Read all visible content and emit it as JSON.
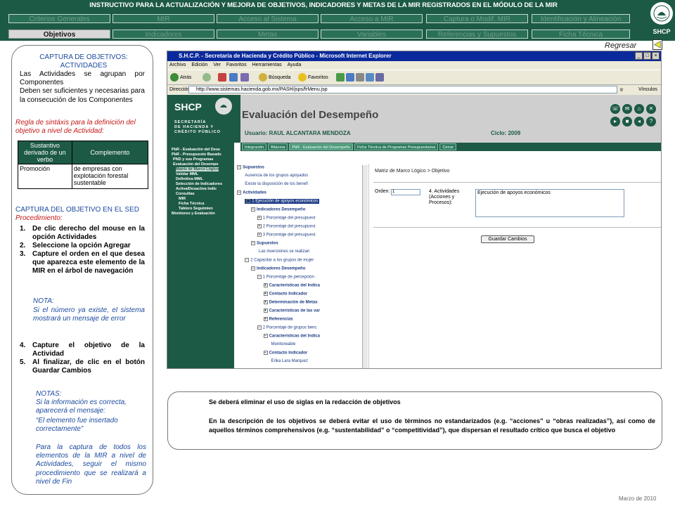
{
  "header": {
    "title": "INSTRUCTIVO PARA  LA ACTUALIZACIÓN Y MEJORA DE OBJETIVOS, INDICADORES Y METAS DE LA MIR REGISTRADOS EN EL MÓDULO DE LA MIR",
    "nav_row1": [
      "Criterios Generales",
      "MIR",
      "Acceso al Sistema",
      "Acceso a MIR",
      "Captura o Modif. MIR",
      "Identificación y Alineación"
    ],
    "nav_row2": [
      "Objetivos",
      "Indicadores",
      "Metas",
      "Variables",
      "Referencias y Supuestos",
      "Ficha Técnica"
    ],
    "active_tab": "Objetivos",
    "logo_text": "SHCP",
    "colors": {
      "header_bg": "#1d5a45",
      "inactive_btn": "#2a7057",
      "active_btn": "#d8d8d8"
    }
  },
  "regresar": "Regresar",
  "left_panel": {
    "heading": "CAPTURA DE OBJETIVOS: ACTIVIDADES",
    "intro": "Las Actividades se agrupan por Componentes\nDeben ser suficientes y necesarias para la consecución de los Componentes",
    "rule": "Regla de sintáxis para la definición del objetivo a nivel de Actividad:",
    "table": {
      "headers": [
        "Sustantivo derivado de un verbo",
        "Complemento"
      ],
      "row": [
        "Promoción",
        "de empresas con explotación forestal sustentable"
      ]
    },
    "capture_heading": "CAPTURA DEL OBJETIVO EN EL SED",
    "procedure_label": "Procedimiento:",
    "steps_a": [
      {
        "n": "1.",
        "t": "De clic derecho del mouse en la opción Actividades"
      },
      {
        "n": "2.",
        "t": "Seleccione la opción Agregar"
      },
      {
        "n": "3.",
        "t": "Capture el orden en el que desea que aparezca este elemento de la MIR en el árbol de navegación"
      }
    ],
    "nota_label": "NOTA:",
    "nota_text": "Si el número ya existe, el sistema mostrará un mensaje de error",
    "steps_b": [
      {
        "n": "4.",
        "t": "Capture el objetivo de la Actividad"
      },
      {
        "n": "5.",
        "t": "Al finalizar, de clic en el botón Guardar Cambios"
      }
    ],
    "notas_label": "NOTAS:",
    "notas_text1": "Si la información es correcta, aparecerá el mensaje:",
    "notas_quote": "“El elemento fue insertado correctamente”",
    "notas_text2": "Para la captura de todos los elementos de la MIR a nivel de Actividades, seguir el mismo procedimiento que se realizará a nivel de Fin"
  },
  "browser": {
    "title": "S.H.C.P. - Secretaría de Hacienda y Crédito Público - Microsoft Internet Explorer",
    "menu": [
      "Archivo",
      "Edición",
      "Ver",
      "Favoritos",
      "Herramientas",
      "Ayuda"
    ],
    "toolbar": {
      "back": "Atrás",
      "search": "Búsqueda",
      "favorites": "Favoritos"
    },
    "address_label": "Dirección",
    "address": "http://www.sistemas.hacienda.gob.mx/PASH/jsps/frMenu.jsp",
    "go": "Ir",
    "links": "Vínculos"
  },
  "app": {
    "logo": "SHCP",
    "secretaria": "SECRETARÍA\nDE HACIENDA Y\nCRÉDITO PÚBLICO",
    "title": "Evaluación del Desempeño",
    "user": "Usuario: RAUL ALCANTARA MENDOZA",
    "ciclo": "Ciclo: 2009",
    "tabs": [
      "Integración",
      "Bitácora",
      "PbR - Evaluación del Desempeño",
      "Ficha Técnica de Programas Presupuestarios",
      "Cerrar"
    ],
    "sidebar": [
      "PbR - Evaluación del Dese",
      "PbR - Presupuesto Basado",
      "PND y sus Programas",
      "Evaluación del Desempe",
      "Matriz de Marco Lógico",
      "Validar MML",
      "Definitiva MML",
      "Selección de Indicadores",
      "Activa/Desactiva Indic",
      "Consultas",
      "MIR",
      "Ficha Técnica",
      "Tablero Seguimien",
      "Monitoreo y Evaluación"
    ],
    "tree": [
      {
        "t": "Supuestos",
        "x": 2,
        "b": true,
        "box": "−"
      },
      {
        "t": "Ausencia de los grupos apoyados",
        "x": 12
      },
      {
        "t": "Existe la disposición de los benefi",
        "x": 12
      },
      {
        "t": "Actividades",
        "x": 2,
        "b": true,
        "box": "−"
      },
      {
        "t": "1 Ejecución de apoyos económicos",
        "x": 12,
        "sel": true,
        "box": "−"
      },
      {
        "t": "Indicadores Desempeño",
        "x": 20,
        "b": true,
        "box": "−"
      },
      {
        "t": "1 Porcentaje del presupuest",
        "x": 28,
        "box": "+"
      },
      {
        "t": "2 Porcentaje del presupuest",
        "x": 28,
        "box": "+"
      },
      {
        "t": "3 Porcentaje del presupuest",
        "x": 28,
        "box": "+"
      },
      {
        "t": "Supuestos",
        "x": 20,
        "b": true,
        "box": "−"
      },
      {
        "t": "Las inversiones se realizan",
        "x": 30
      },
      {
        "t": "2 Capacitar a los grupos de mujer",
        "x": 12,
        "box": "−"
      },
      {
        "t": "Indicadores Desempeño",
        "x": 20,
        "b": true,
        "box": "−"
      },
      {
        "t": "1 Porcentaje de percepción ·",
        "x": 28,
        "box": "−"
      },
      {
        "t": "Características del Indica",
        "x": 36,
        "b": true,
        "box": "+"
      },
      {
        "t": "Contacto Indicador",
        "x": 36,
        "b": true,
        "box": "+"
      },
      {
        "t": "Determinación de Metas",
        "x": 36,
        "b": true,
        "box": "+"
      },
      {
        "t": "Características de las var",
        "x": 36,
        "b": true,
        "box": "+"
      },
      {
        "t": "Referencias",
        "x": 36,
        "b": true,
        "box": "+"
      },
      {
        "t": "2 Porcentaje de grupos benc",
        "x": 28,
        "box": "−"
      },
      {
        "t": "Características del Indica",
        "x": 36,
        "b": true,
        "box": "−"
      },
      {
        "t": "Monitoreable",
        "x": 46
      },
      {
        "t": "Contacto Indicador",
        "x": 36,
        "b": true,
        "box": "−"
      },
      {
        "t": "Erika Lara Marquez",
        "x": 46
      }
    ],
    "form": {
      "breadcrumb": "Matriz de Marco Lógico > Objetivo",
      "orden_label": "Orden:",
      "orden_value": "1",
      "act_label": "4. Actividades (Acciones y Procesos):",
      "act_value": "Ejecución de apoyos económicos",
      "save": "Guardar Cambios"
    }
  },
  "notes": {
    "line1": "Se deberá eliminar el uso de siglas en la redacción de objetivos",
    "line2": "En la descripción de los objetivos se deberá evitar el uso de términos no estandarizados (e.g. “acciones” u “obras realizadas”), así como de aquellos términos comprehensivos (e.g. “sustentabilidad” o “competitividad”), que dispersan el resultado crítico que busca el objetivo"
  },
  "footer_date": "Marzo de 2010"
}
